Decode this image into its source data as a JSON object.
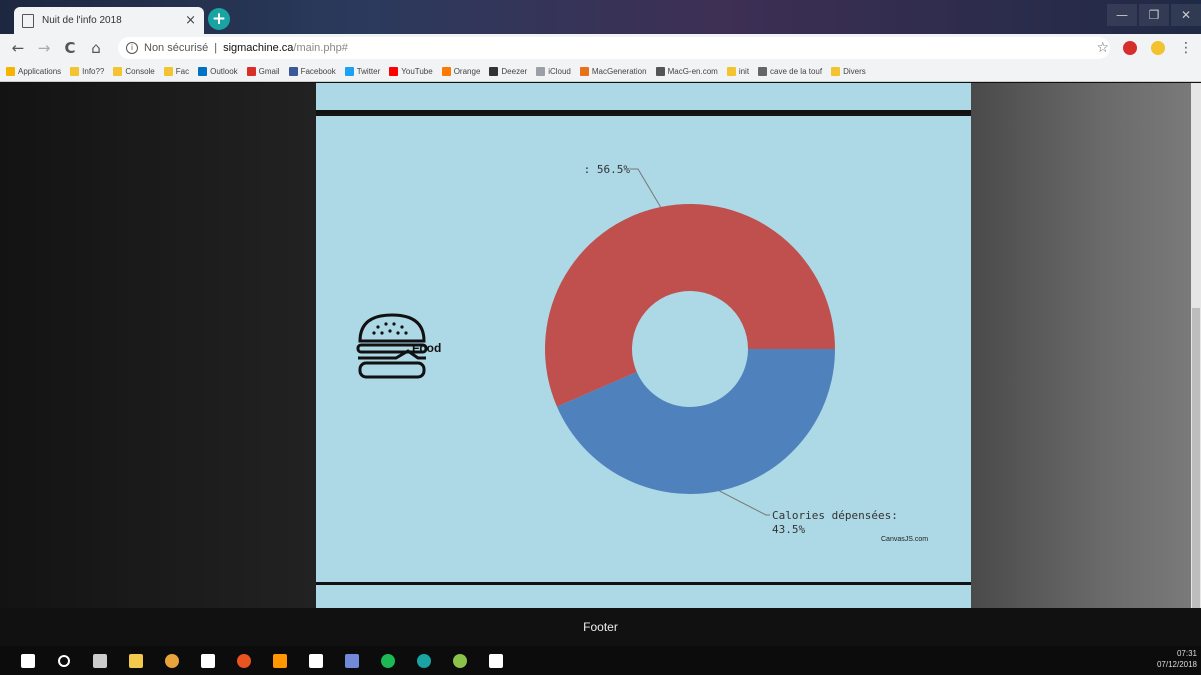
{
  "browser": {
    "tab_title": "Nuit de l'info 2018",
    "tab_close": "×",
    "new_tab": "+",
    "window_controls": [
      "—",
      "❐",
      "✕"
    ],
    "nav": {
      "back": "←",
      "forward": "→",
      "reload": "C",
      "home": "⌂"
    },
    "address": {
      "security": "Non sécurisé",
      "separator": "|",
      "host": "sigmachine.ca",
      "path": "/main.php#"
    },
    "star": "☆",
    "menu": "⋮",
    "bookmarks": [
      {
        "label": "Applications",
        "color": "#f4b400"
      },
      {
        "label": "Info??",
        "color": "#f4c430"
      },
      {
        "label": "Console",
        "color": "#f4c430"
      },
      {
        "label": "Fac",
        "color": "#f4c430"
      },
      {
        "label": "Outlook",
        "color": "#0072c6"
      },
      {
        "label": "Gmail",
        "color": "#d93025"
      },
      {
        "label": "Facebook",
        "color": "#3b5998"
      },
      {
        "label": "Twitter",
        "color": "#1da1f2"
      },
      {
        "label": "YouTube",
        "color": "#ff0000"
      },
      {
        "label": "Orange",
        "color": "#ff7900"
      },
      {
        "label": "Deezer",
        "color": "#333333"
      },
      {
        "label": "iCloud",
        "color": "#9aa0a6"
      },
      {
        "label": "MacGeneration",
        "color": "#e8711a"
      },
      {
        "label": "MacG-en.com",
        "color": "#555555"
      },
      {
        "label": "init",
        "color": "#f4c430"
      },
      {
        "label": "cave de la touf",
        "color": "#666666"
      },
      {
        "label": "Divers",
        "color": "#f4c430"
      }
    ]
  },
  "page": {
    "food_label": "Food",
    "credit": "CanvasJS.com",
    "footer": "Footer"
  },
  "chart_data": {
    "type": "pie",
    "style": "doughnut",
    "slices": [
      {
        "label": "",
        "value": 56.5,
        "display": ": 56.5%",
        "color": "#c0504e"
      },
      {
        "label": "Calories dépensées",
        "value": 43.5,
        "display": "Calories dépensées:",
        "display2": "43.5%",
        "color": "#4f81bc"
      }
    ]
  },
  "taskbar": {
    "icons": [
      "windows-icon",
      "cortana-icon",
      "task-view-icon",
      "file-explorer-icon",
      "chrome-icon",
      "mail-icon",
      "ubuntu-icon",
      "sublime-icon",
      "notes-icon",
      "discord-icon",
      "spotify-icon",
      "vpn-icon",
      "android-icon",
      "settings-icon"
    ],
    "time": "07:31",
    "date": "07/12/2018"
  }
}
